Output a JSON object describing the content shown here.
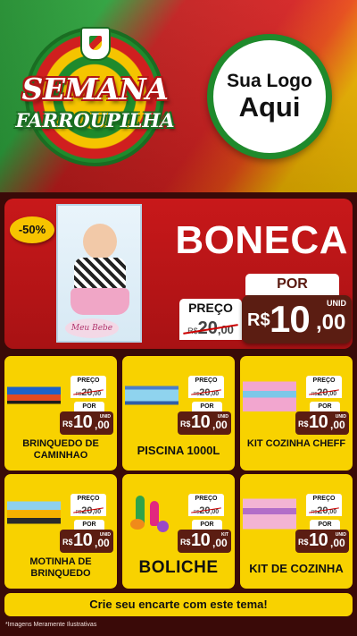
{
  "header": {
    "brand_line1": "SEMANA",
    "brand_line2": "FARROUPILHA",
    "logo_line1": "Sua Logo",
    "logo_line2": "Aqui"
  },
  "hero": {
    "discount": "-50%",
    "title": "BONECA",
    "box_label": "Meu Bebe",
    "old_label": "PREÇO",
    "old_currency": "R$",
    "old_int": "20",
    "old_dec": ",00",
    "new_label": "POR",
    "currency": "R$",
    "price_int": "10",
    "price_dec": ",00",
    "unit": "UNID"
  },
  "products": [
    {
      "name": "BRINQUEDO DE CAMINHAO",
      "old_label": "PREÇO",
      "old_currency": "R$",
      "old_int": "20",
      "old_dec": ",00",
      "new_label": "POR",
      "currency": "R$",
      "price_int": "10",
      "price_dec": ",00",
      "unit": "UNID",
      "icon": "truck-icon"
    },
    {
      "name": "PISCINA 1000L",
      "old_label": "PREÇO",
      "old_currency": "R$",
      "old_int": "20",
      "old_dec": ",00",
      "new_label": "POR",
      "currency": "R$",
      "price_int": "10",
      "price_dec": ",00",
      "unit": "UNID",
      "icon": "pool-icon"
    },
    {
      "name": "KIT COZINHA CHEFF",
      "old_label": "PREÇO",
      "old_currency": "R$",
      "old_int": "20",
      "old_dec": ",00",
      "new_label": "POR",
      "currency": "R$",
      "price_int": "10",
      "price_dec": ",00",
      "unit": "UNID",
      "icon": "kitchen-icon"
    },
    {
      "name": "MOTINHA DE BRINQUEDO",
      "old_label": "PREÇO",
      "old_currency": "R$",
      "old_int": "20",
      "old_dec": ",00",
      "new_label": "POR",
      "currency": "R$",
      "price_int": "10",
      "price_dec": ",00",
      "unit": "UNID",
      "icon": "motorcycle-icon"
    },
    {
      "name": "BOLICHE",
      "old_label": "PREÇO",
      "old_currency": "R$",
      "old_int": "20",
      "old_dec": ",00",
      "new_label": "POR",
      "currency": "R$",
      "price_int": "10",
      "price_dec": ",00",
      "unit": "KIT",
      "icon": "bowling-icon"
    },
    {
      "name": "KIT DE COZINHA",
      "old_label": "PREÇO",
      "old_currency": "R$",
      "old_int": "20",
      "old_dec": ",00",
      "new_label": "POR",
      "currency": "R$",
      "price_int": "10",
      "price_dec": ",00",
      "unit": "UNID",
      "icon": "kitchen-set-icon"
    }
  ],
  "footer": {
    "cta": "Crie seu encarte com este tema!",
    "disclaimer": "*Imagens Meramente Ilustrativas"
  },
  "colors": {
    "green": "#1f8a2c",
    "red": "#c8181a",
    "yellow": "#f8d200",
    "price_brown": "#5b1d12",
    "background": "#3a0a08"
  }
}
